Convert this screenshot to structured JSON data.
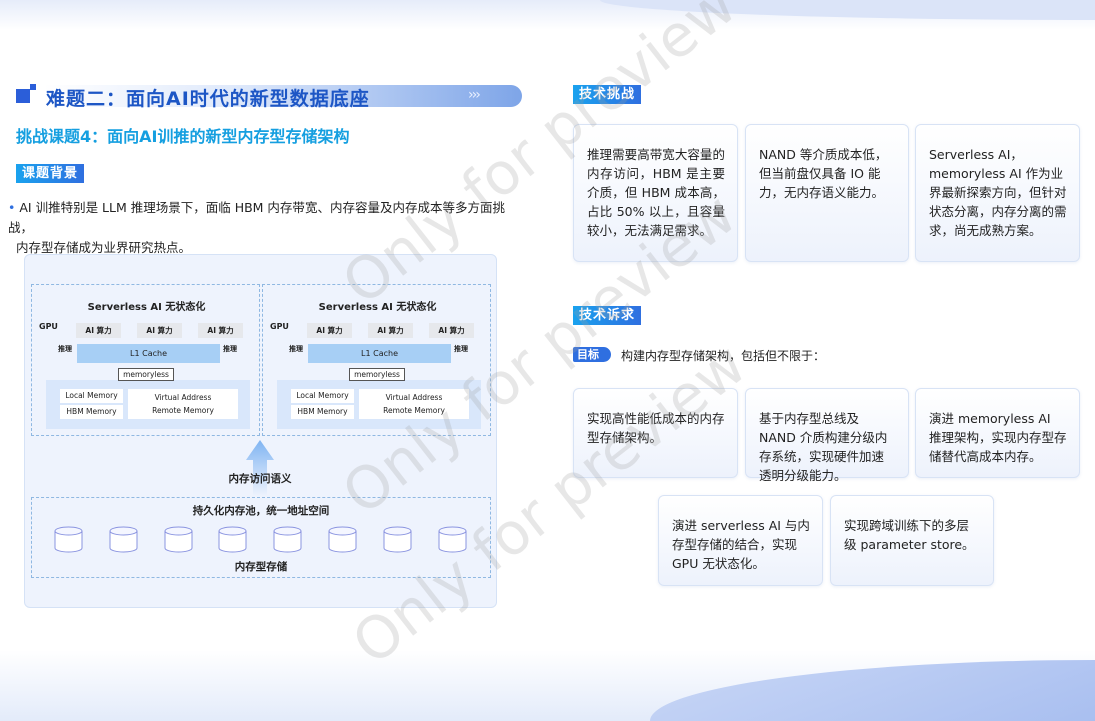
{
  "header": {
    "title": "难题二：面向AI时代的新型数据底座",
    "chevrons": "›››",
    "subtitle": "挑战课题4：面向AI训推的新型内存型存储架构"
  },
  "background": {
    "tag": "课题背景",
    "text_line1": "AI 训推特别是 LLM 推理场景下，面临 HBM 内存带宽、内存容量及内存成本等多方面挑战，",
    "text_line2": "内存型存储成为业界研究热点。"
  },
  "diagram": {
    "nodes": [
      {
        "title": "Serverless AI 无状态化",
        "gpu": "GPU",
        "compute": [
          "AI 算力",
          "AI 算力",
          "AI 算力"
        ],
        "infer_left": "推理",
        "infer_right": "推理",
        "cache": "L1 Cache",
        "memoryless": "memoryless",
        "local": "Local Memory",
        "hbm": "HBM Memory",
        "virtual": "Virtual Address",
        "remote": "Remote Memory"
      },
      {
        "title": "Serverless AI 无状态化",
        "gpu": "GPU",
        "compute": [
          "AI 算力",
          "AI 算力",
          "AI 算力"
        ],
        "infer_left": "推理",
        "infer_right": "推理",
        "cache": "L1 Cache",
        "memoryless": "memoryless",
        "local": "Local Memory",
        "hbm": "HBM Memory",
        "virtual": "Virtual Address",
        "remote": "Remote Memory"
      }
    ],
    "arrow_label": "内存访问语义",
    "pool_title": "持久化内存池，统一地址空间",
    "storage_label": "内存型存储",
    "cylinder_count": 8
  },
  "challenges": {
    "tag": "技术挑战",
    "cards": [
      "推理需要高带宽大容量的内存访问，HBM 是主要介质，但 HBM 成本高，占比 50% 以上，且容量较小，无法满足需求。",
      "NAND 等介质成本低，但当前盘仅具备 IO 能力，无内存语义能力。",
      "Serverless AI，memoryless AI 作为业界最新探索方向，但针对状态分离，内存分离的需求，尚无成熟方案。"
    ]
  },
  "demands": {
    "tag": "技术诉求",
    "goal_badge": "目标",
    "goal_text": "构建内存型存储架构，包括但不限于：",
    "cards": [
      "实现高性能低成本的内存型存储架构。",
      "基于内存型总线及 NAND 介质构建分级内存系统，实现硬件加速透明分级能力。",
      "演进 memoryless AI 推理架构，实现内存型存储替代高成本内存。",
      "演进 serverless AI 与内存型存储的结合，实现 GPU 无状态化。",
      "实现跨域训练下的多层级 parameter store。"
    ]
  },
  "watermark": "Only for preview",
  "colors": {
    "primary": "#1d56c5",
    "accent": "#159fe0"
  }
}
